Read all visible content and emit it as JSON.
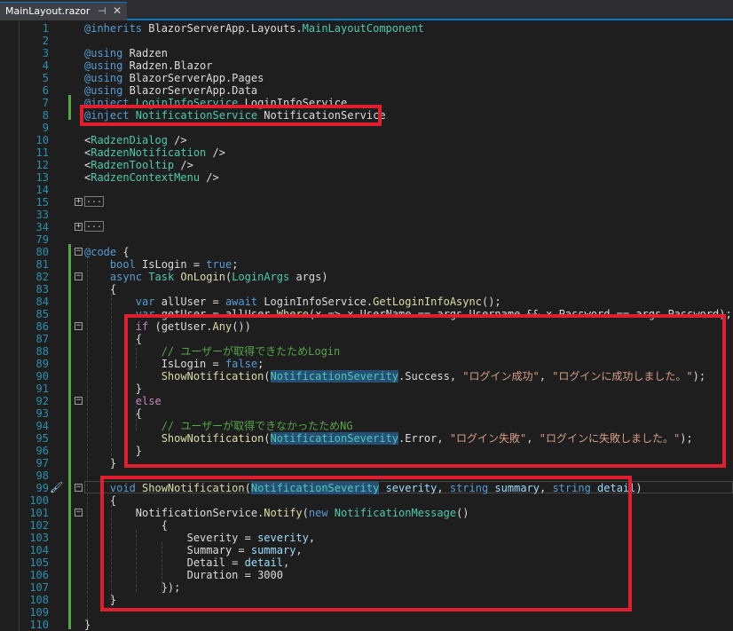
{
  "tab": {
    "filename": "MainLayout.razor",
    "pin_icon": "pin-icon",
    "close_icon": "close-icon"
  },
  "lines": [
    {
      "n": "1",
      "segs": [
        [
          "k",
          "@inherits "
        ],
        [
          "",
          "BlazorServerApp.Layouts."
        ],
        [
          "t",
          "MainLayoutComponent"
        ]
      ]
    },
    {
      "n": "2",
      "segs": []
    },
    {
      "n": "3",
      "segs": [
        [
          "k",
          "@using "
        ],
        [
          "",
          "Radzen"
        ]
      ]
    },
    {
      "n": "4",
      "segs": [
        [
          "k",
          "@using "
        ],
        [
          "",
          "Radzen.Blazor"
        ]
      ]
    },
    {
      "n": "5",
      "segs": [
        [
          "k",
          "@using "
        ],
        [
          "",
          "BlazorServerApp.Pages"
        ]
      ]
    },
    {
      "n": "6",
      "segs": [
        [
          "k",
          "@using "
        ],
        [
          "",
          "BlazorServerApp.Data"
        ]
      ]
    },
    {
      "n": "7",
      "segs": [
        [
          "k",
          "@inject "
        ],
        [
          "t",
          "LoginInfoService "
        ],
        [
          "",
          "LoginInfoService"
        ]
      ]
    },
    {
      "n": "8",
      "segs": [
        [
          "k",
          "@inject "
        ],
        [
          "t",
          "NotificationService "
        ],
        [
          "",
          "NotificationService"
        ]
      ]
    },
    {
      "n": "9",
      "segs": []
    },
    {
      "n": "10",
      "segs": [
        [
          "",
          "<"
        ],
        [
          "t",
          "RadzenDialog "
        ],
        [
          "",
          "/>"
        ]
      ]
    },
    {
      "n": "11",
      "segs": [
        [
          "",
          "<"
        ],
        [
          "t",
          "RadzenNotification "
        ],
        [
          "",
          "/>"
        ]
      ]
    },
    {
      "n": "12",
      "segs": [
        [
          "",
          "<"
        ],
        [
          "t",
          "RadzenTooltip "
        ],
        [
          "",
          "/>"
        ]
      ]
    },
    {
      "n": "13",
      "segs": [
        [
          "",
          "<"
        ],
        [
          "t",
          "RadzenContextMenu "
        ],
        [
          "",
          "/>"
        ]
      ]
    },
    {
      "n": "14",
      "segs": []
    },
    {
      "n": "15",
      "segs": [],
      "collapsed": "..."
    },
    {
      "n": "33",
      "segs": []
    },
    {
      "n": "34",
      "segs": [],
      "collapsed": "..."
    },
    {
      "n": "79",
      "segs": []
    },
    {
      "n": "80",
      "segs": [
        [
          "k",
          "@code "
        ],
        [
          "",
          "{"
        ]
      ]
    },
    {
      "n": "81",
      "segs": [
        [
          "",
          "    "
        ],
        [
          "k",
          "bool "
        ],
        [
          "",
          "IsLogin = "
        ],
        [
          "k",
          "true"
        ],
        [
          "",
          ";"
        ]
      ]
    },
    {
      "n": "82",
      "segs": [
        [
          "",
          "    "
        ],
        [
          "k",
          "async "
        ],
        [
          "t",
          "Task "
        ],
        [
          "m",
          "OnLogin"
        ],
        [
          "",
          "("
        ],
        [
          "t",
          "LoginArgs "
        ],
        [
          "",
          "args)"
        ]
      ]
    },
    {
      "n": "83",
      "segs": [
        [
          "",
          "    {"
        ]
      ]
    },
    {
      "n": "84",
      "segs": [
        [
          "",
          "        "
        ],
        [
          "k",
          "var "
        ],
        [
          "",
          "allUser = "
        ],
        [
          "k",
          "await "
        ],
        [
          "",
          "LoginInfoService."
        ],
        [
          "m",
          "GetLoginInfoAsync"
        ],
        [
          "",
          "();"
        ]
      ]
    },
    {
      "n": "85",
      "segs": [
        [
          "",
          "        "
        ],
        [
          "k",
          "var "
        ],
        [
          "",
          "getUser = allUser."
        ],
        [
          "m",
          "Where"
        ],
        [
          "",
          "(x => x.UserName == args.Username && x.Password == args.Password);"
        ]
      ]
    },
    {
      "n": "86",
      "segs": [
        [
          "",
          "        "
        ],
        [
          "pl",
          "if "
        ],
        [
          "",
          "(getUser."
        ],
        [
          "m",
          "Any"
        ],
        [
          "",
          "())"
        ]
      ]
    },
    {
      "n": "87",
      "segs": [
        [
          "",
          "        {"
        ]
      ]
    },
    {
      "n": "88",
      "segs": [
        [
          "",
          "            "
        ],
        [
          "c",
          "// ユーザーが取得できたためLogin"
        ]
      ]
    },
    {
      "n": "89",
      "segs": [
        [
          "",
          "            IsLogin = "
        ],
        [
          "k",
          "false"
        ],
        [
          "",
          ";"
        ]
      ]
    },
    {
      "n": "90",
      "segs": [
        [
          "",
          "            "
        ],
        [
          "m",
          "ShowNotification"
        ],
        [
          "",
          "("
        ],
        [
          "hlt",
          "NotificationSeverity"
        ],
        [
          "",
          ".Success, "
        ],
        [
          "s",
          "\"ログイン成功\""
        ],
        [
          "",
          ", "
        ],
        [
          "s",
          "\"ログインに成功しました。\""
        ],
        [
          "",
          ");"
        ]
      ]
    },
    {
      "n": "91",
      "segs": [
        [
          "",
          "        }"
        ]
      ]
    },
    {
      "n": "92",
      "segs": [
        [
          "",
          "        "
        ],
        [
          "pl",
          "else"
        ]
      ]
    },
    {
      "n": "93",
      "segs": [
        [
          "",
          "        {"
        ]
      ]
    },
    {
      "n": "94",
      "segs": [
        [
          "",
          "            "
        ],
        [
          "c",
          "// ユーザーが取得できなかったためNG"
        ]
      ]
    },
    {
      "n": "95",
      "segs": [
        [
          "",
          "            "
        ],
        [
          "m",
          "ShowNotification"
        ],
        [
          "",
          "("
        ],
        [
          "hlt",
          "NotificationSeverity"
        ],
        [
          "",
          ".Error, "
        ],
        [
          "s",
          "\"ログイン失敗\""
        ],
        [
          "",
          ", "
        ],
        [
          "s",
          "\"ログインに失敗しました。\""
        ],
        [
          "",
          ");"
        ]
      ]
    },
    {
      "n": "96",
      "segs": [
        [
          "",
          "        }"
        ]
      ]
    },
    {
      "n": "97",
      "segs": [
        [
          "",
          "    }"
        ]
      ]
    },
    {
      "n": "98",
      "segs": []
    },
    {
      "n": "99",
      "segs": [
        [
          "",
          "    "
        ],
        [
          "k",
          "void "
        ],
        [
          "m",
          "ShowNotification"
        ],
        [
          "",
          "("
        ],
        [
          "hlt",
          "NotificationSeverity"
        ],
        [
          "",
          ""
        ],
        [
          "v",
          " severity"
        ],
        [
          "",
          ", "
        ],
        [
          "k",
          "string "
        ],
        [
          "v",
          "summary"
        ],
        [
          "",
          ", "
        ],
        [
          "k",
          "string "
        ],
        [
          "v",
          "detail"
        ],
        [
          "",
          ")"
        ]
      ]
    },
    {
      "n": "100",
      "segs": [
        [
          "",
          "    {"
        ]
      ]
    },
    {
      "n": "101",
      "segs": [
        [
          "",
          "        NotificationService."
        ],
        [
          "m",
          "Notify"
        ],
        [
          "",
          "("
        ],
        [
          "k",
          "new "
        ],
        [
          "t",
          "NotificationMessage"
        ],
        [
          "",
          "()"
        ]
      ]
    },
    {
      "n": "102",
      "segs": [
        [
          "",
          "            {"
        ]
      ]
    },
    {
      "n": "103",
      "segs": [
        [
          "",
          "                Severity = "
        ],
        [
          "v",
          "severity"
        ],
        [
          "",
          ","
        ]
      ]
    },
    {
      "n": "104",
      "segs": [
        [
          "",
          "                Summary = "
        ],
        [
          "v",
          "summary"
        ],
        [
          "",
          ","
        ]
      ]
    },
    {
      "n": "105",
      "segs": [
        [
          "",
          "                Detail = "
        ],
        [
          "v",
          "detail"
        ],
        [
          "",
          ","
        ]
      ]
    },
    {
      "n": "106",
      "segs": [
        [
          "",
          "                Duration = 3000"
        ]
      ]
    },
    {
      "n": "107",
      "segs": [
        [
          "",
          "            });"
        ]
      ]
    },
    {
      "n": "108",
      "segs": [
        [
          "",
          "    }"
        ]
      ]
    },
    {
      "n": "109",
      "segs": []
    },
    {
      "n": "110",
      "segs": [
        [
          "",
          "}"
        ]
      ]
    }
  ]
}
